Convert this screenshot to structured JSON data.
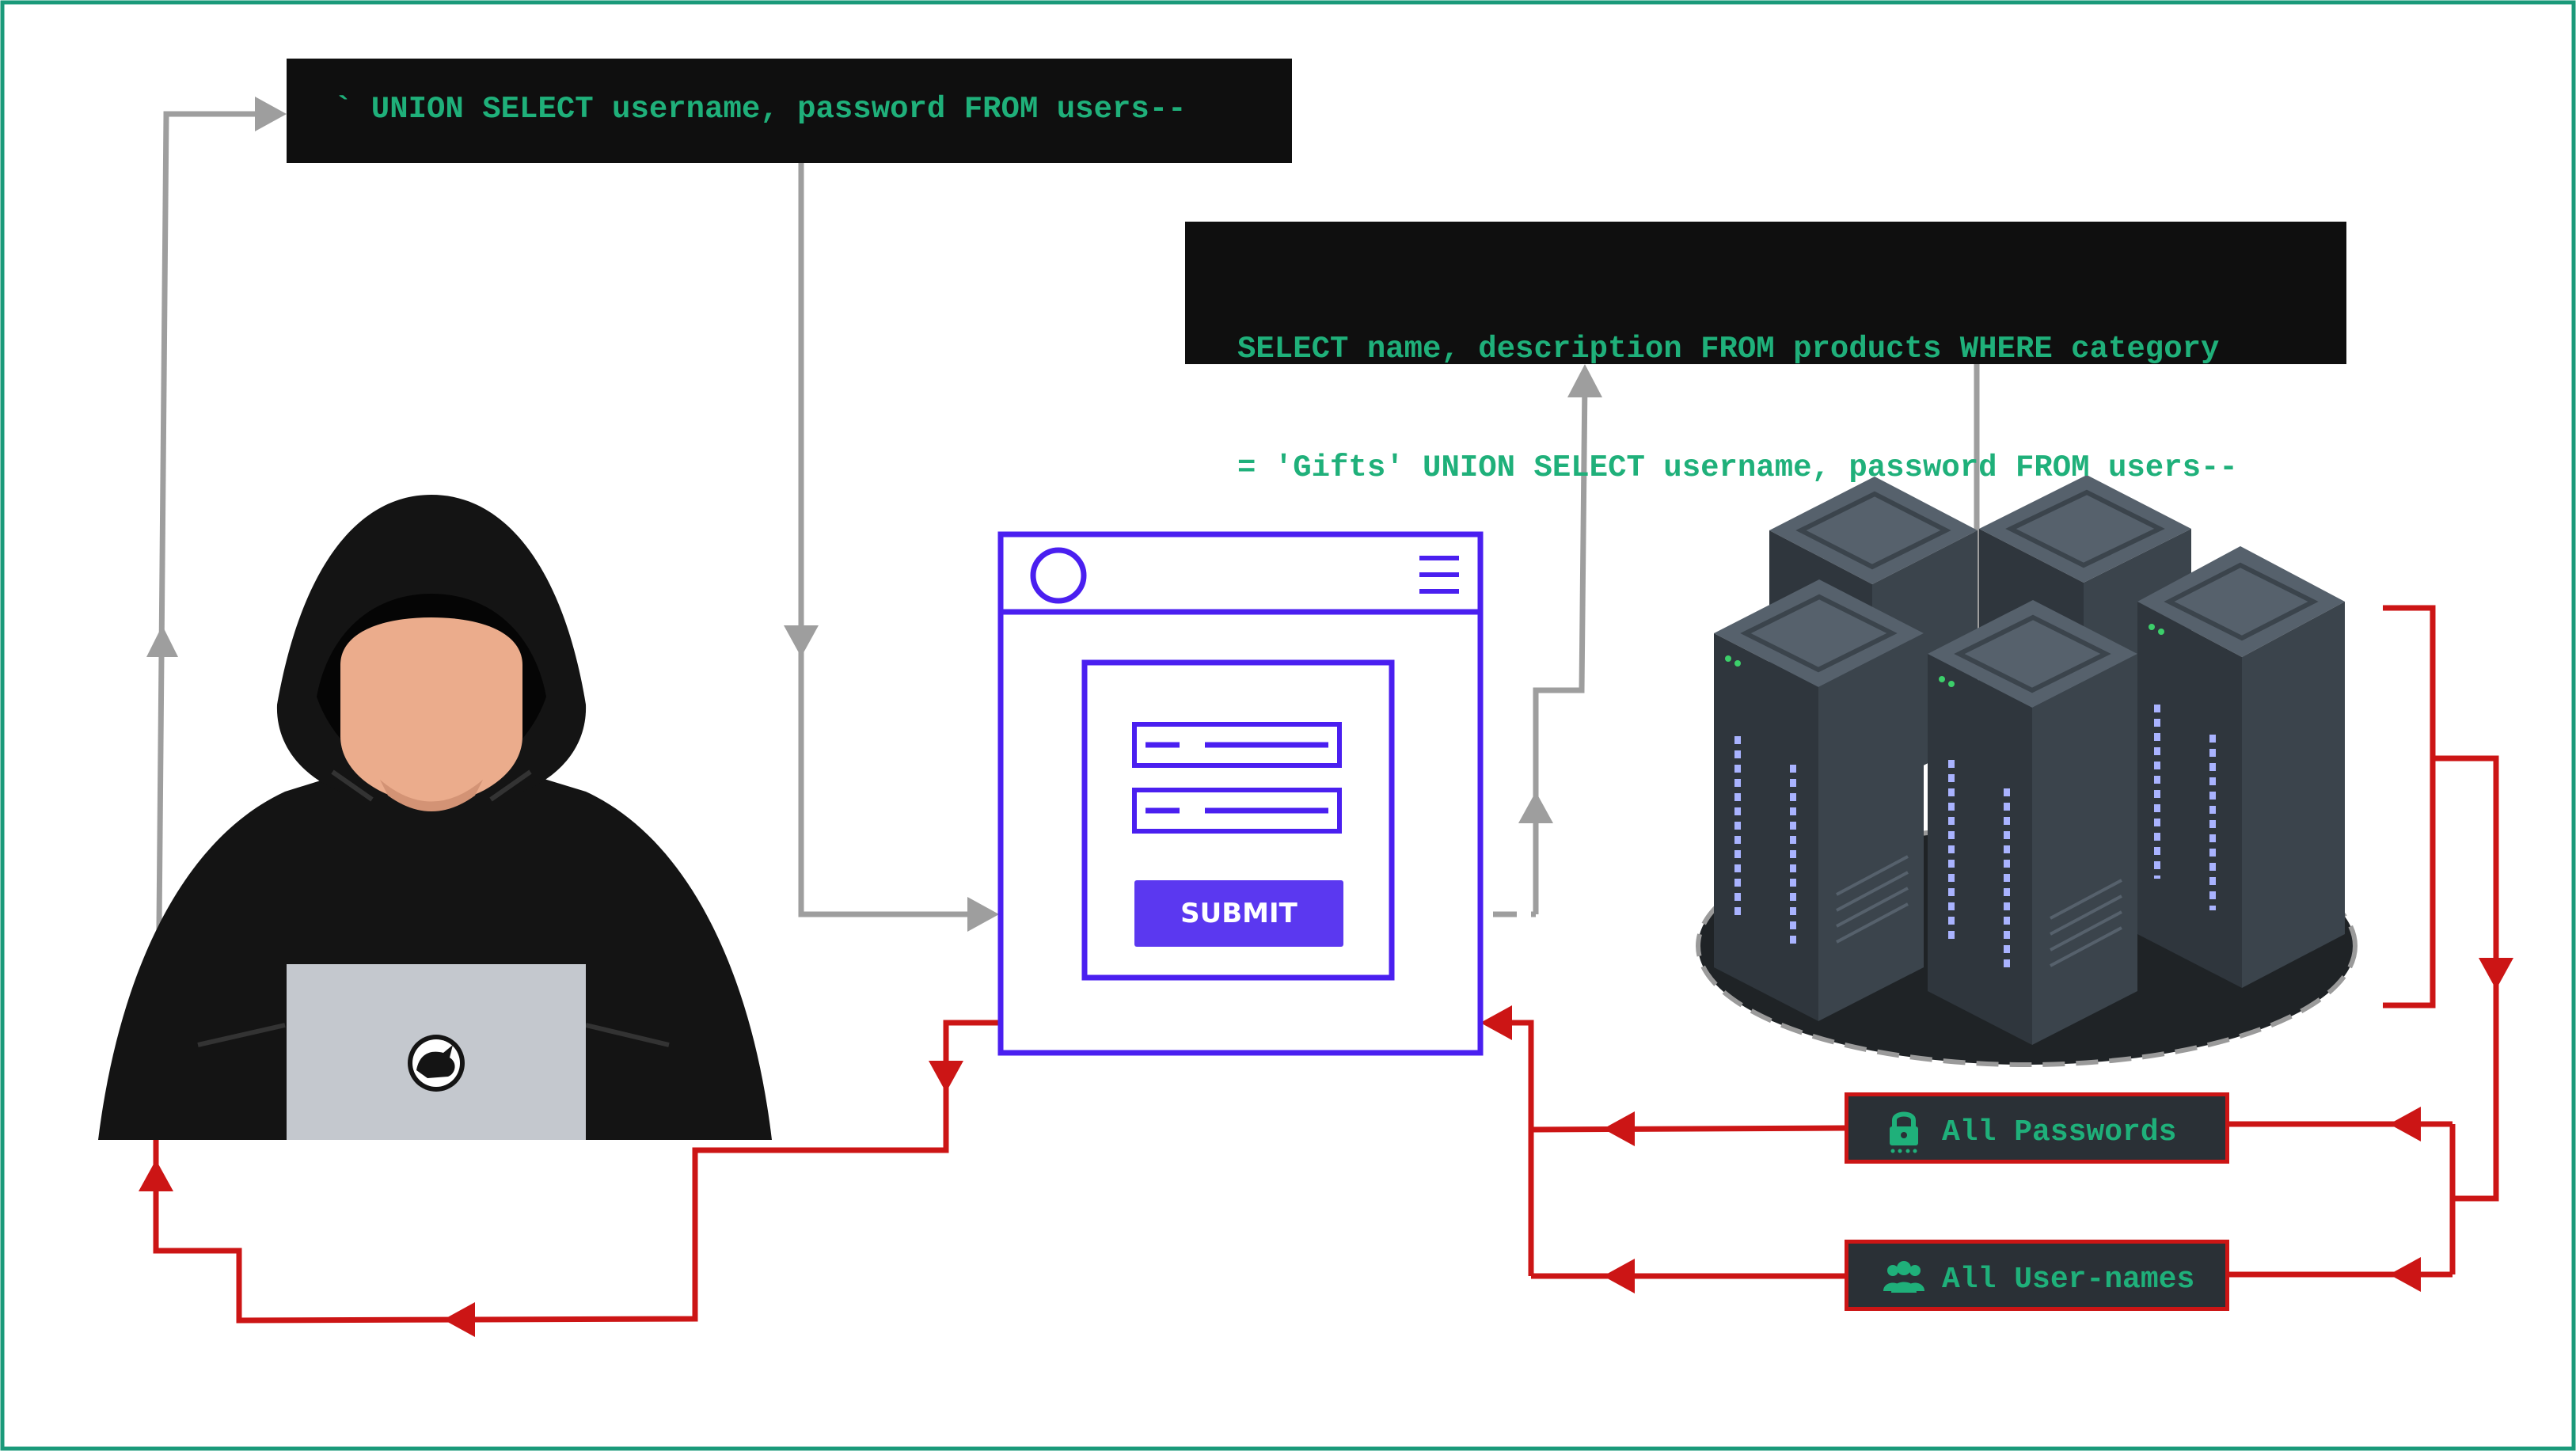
{
  "payload": {
    "text": "` UNION SELECT username, password FROM users--"
  },
  "query": {
    "line1": "SELECT name, description FROM products WHERE category",
    "line2": "= 'Gifts' UNION SELECT username, password FROM users--"
  },
  "form": {
    "submit_label": "SUBMIT"
  },
  "results": {
    "passwords_label": "All Passwords",
    "passwords_icon": "lock-icon",
    "usernames_label": "All User-names",
    "usernames_icon": "users-icon"
  },
  "colors": {
    "request_flow": "#9e9e9e",
    "response_flow": "#cc1515",
    "code_text": "#1fb07a",
    "form_outline": "#4a1ff0",
    "submit_button": "#5b38f0",
    "frame_border": "#1a9a7a"
  }
}
